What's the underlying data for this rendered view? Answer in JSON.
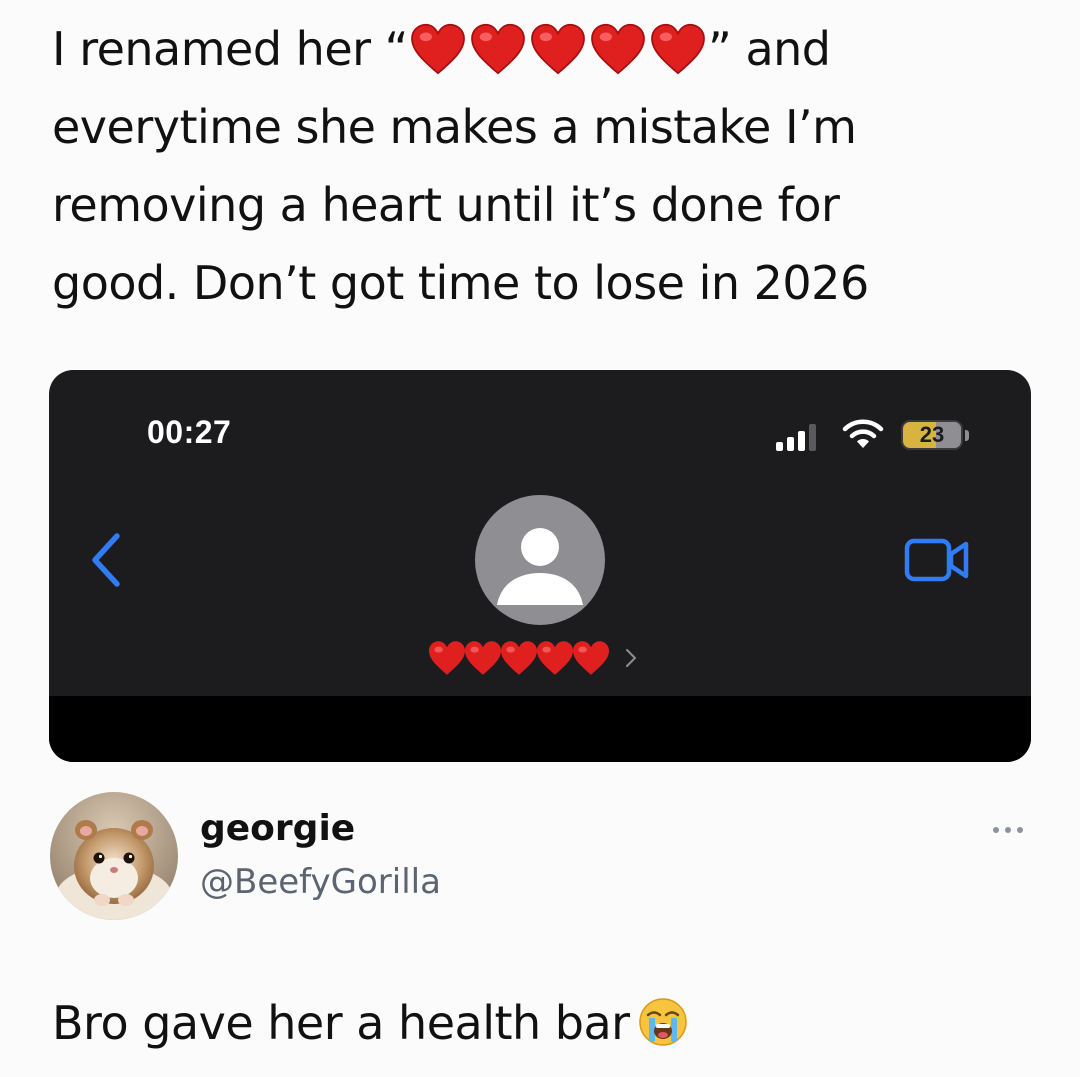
{
  "quote": {
    "line1_before": "I renamed her “",
    "line1_after": "” and",
    "line2": "everytime she makes a mistake I’m",
    "line3": "removing a heart until it’s done for",
    "line4": "good. Don’t got time to lose in 2026",
    "heart_count": 5,
    "heart_emoji": "heart-emoji"
  },
  "phone": {
    "status_time": "00:27",
    "battery_level": "23",
    "battery_fraction": 0.23,
    "signal_icon": "cellular-signal-icon",
    "wifi_icon": "wifi-icon",
    "back_icon": "chevron-left-icon",
    "video_icon": "facetime-video-icon",
    "contact_name_hearts": 5,
    "accent_color": "#2f7cf6",
    "heart_color": "#e0201f"
  },
  "reply": {
    "display_name": "georgie",
    "handle": "@BeefyGorilla",
    "more_icon": "more-options-icon",
    "text": "Bro gave her a health bar",
    "emoji": "loudly-crying-face-emoji"
  }
}
